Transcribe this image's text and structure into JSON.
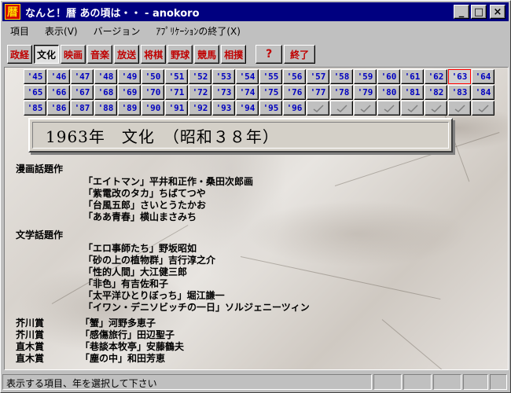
{
  "window": {
    "app_icon_char": "暦",
    "title": "なんと！暦 あの頃は・・ - anokoro",
    "buttons": {
      "minimize": "_",
      "maximize": "□",
      "close": "×"
    }
  },
  "menu": [
    "項目",
    "表示(V)",
    "バージョン",
    "ｱﾌﾟﾘｹｰｼｮﾝの終了(X)"
  ],
  "toolbar": {
    "categories": [
      "政経",
      "文化",
      "映画",
      "音楽",
      "放送",
      "将棋",
      "野球",
      "競馬",
      "相撲"
    ],
    "active_category": "文化",
    "help_label": "?",
    "end_label": "終了"
  },
  "years": {
    "row1": [
      "'45",
      "'46",
      "'47",
      "'48",
      "'49",
      "'50",
      "'51",
      "'52",
      "'53",
      "'54",
      "'55",
      "'56",
      "'57",
      "'58",
      "'59",
      "'60",
      "'61",
      "'62",
      "'63",
      "'64"
    ],
    "row2": [
      "'65",
      "'66",
      "'67",
      "'68",
      "'69",
      "'70",
      "'71",
      "'72",
      "'73",
      "'74",
      "'75",
      "'76",
      "'77",
      "'78",
      "'79",
      "'80",
      "'81",
      "'82",
      "'83",
      "'84"
    ],
    "row3": [
      "'85",
      "'86",
      "'87",
      "'88",
      "'89",
      "'90",
      "'91",
      "'92",
      "'93",
      "'94",
      "'95",
      "'96"
    ],
    "empty_count": 8,
    "selected": "'63"
  },
  "heading": "1963年　文化　（昭和３８年）",
  "manga": {
    "title": "漫画話題作",
    "entries": [
      "「エイトマン」平井和正作・桑田次郎画",
      "「紫電改のタカ」ちばてつや",
      "「台風五郎」さいとうたかお",
      "「ああ青春」横山まさみち"
    ]
  },
  "literature": {
    "title": "文学話題作",
    "entries": [
      "「エロ事師たち」野坂昭如",
      "「砂の上の植物群」吉行淳之介",
      "「性的人間」大江健三郎",
      "「非色」有吉佐和子",
      "「太平洋ひとりぼっち」堀江謙一",
      "「イワン・デニソビッチの一日」ソルジェニーツィン"
    ]
  },
  "awards": [
    {
      "label": "芥川賞",
      "entry": "「蟹」河野多恵子"
    },
    {
      "label": "芥川賞",
      "entry": "「感傷旅行」田辺聖子"
    },
    {
      "label": "直木賞",
      "entry": "「巷談本牧亭」安藤鶴夫"
    },
    {
      "label": "直木賞",
      "entry": "「塵の中」和田芳恵"
    }
  ],
  "status": {
    "text": "表示する項目、年を選択して下さい"
  }
}
